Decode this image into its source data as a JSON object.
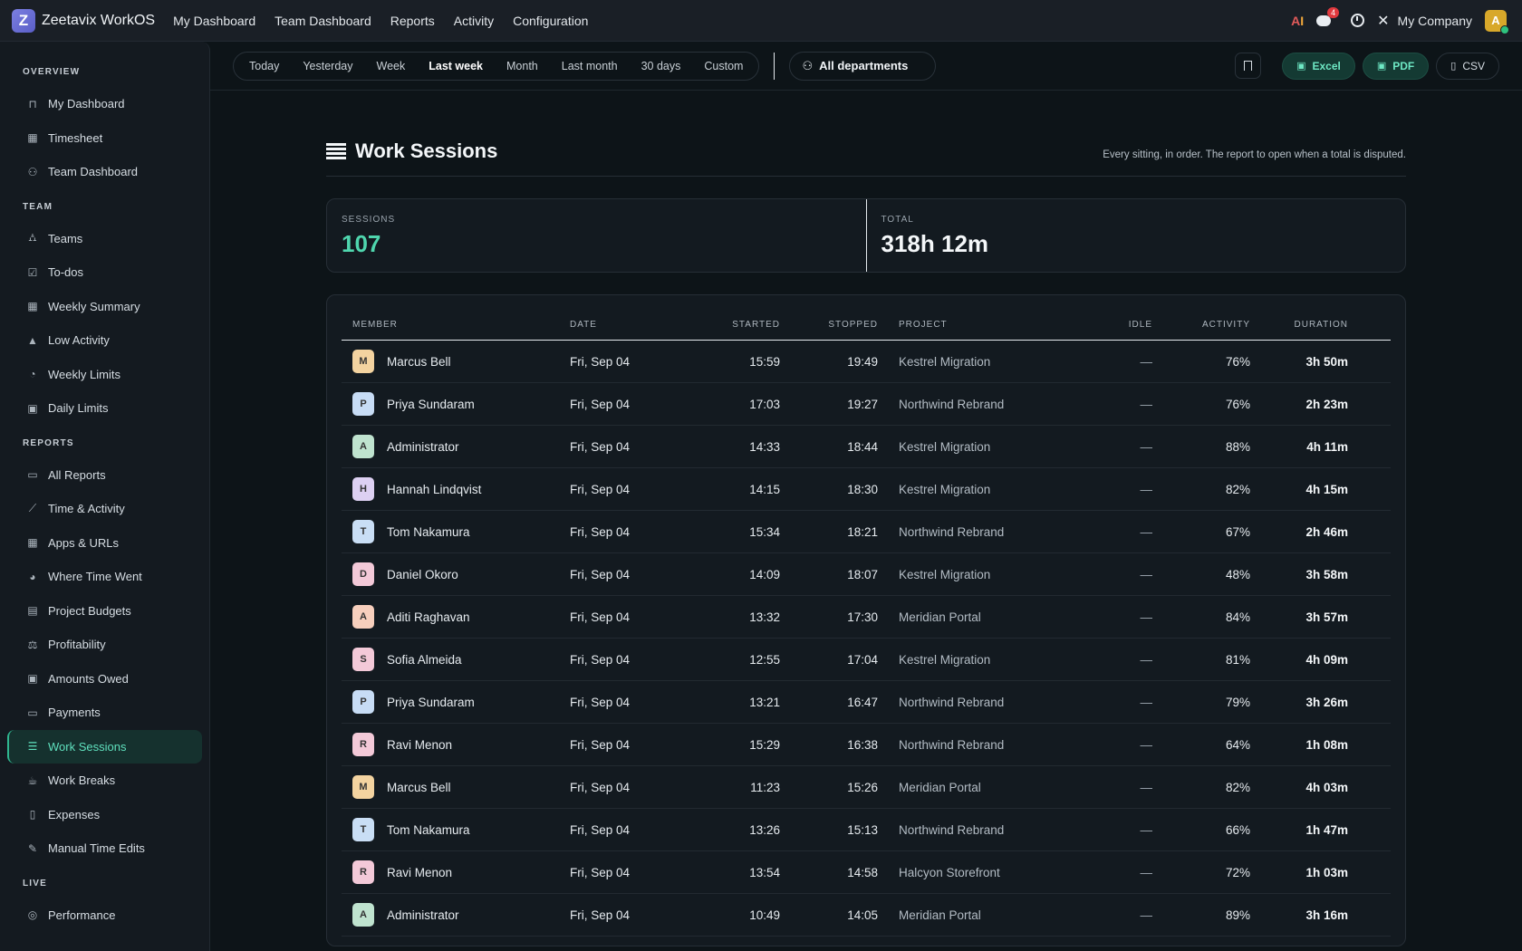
{
  "brand": {
    "logo_letter": "Z",
    "name": "Zeetavix WorkOS"
  },
  "topnav": [
    "My Dashboard",
    "Team Dashboard",
    "Reports",
    "Activity",
    "Configuration"
  ],
  "topright": {
    "ai_label_a": "A",
    "ai_label_i": "I",
    "chat_badge": "4",
    "company": "My Company",
    "avatar_letter": "A"
  },
  "sidebar": {
    "sections": [
      {
        "title": "OVERVIEW",
        "items": [
          {
            "label": "My Dashboard",
            "icon": "lock-icon",
            "glyph": "⊓"
          },
          {
            "label": "Timesheet",
            "icon": "calendar-icon",
            "glyph": "▦"
          },
          {
            "label": "Team Dashboard",
            "icon": "users-icon",
            "glyph": "⚇"
          }
        ]
      },
      {
        "title": "TEAM",
        "items": [
          {
            "label": "Teams",
            "icon": "sitemap-icon",
            "glyph": "⛼"
          },
          {
            "label": "To-dos",
            "icon": "checkbox-icon",
            "glyph": "☑"
          },
          {
            "label": "Weekly Summary",
            "icon": "grid-icon",
            "glyph": "▦"
          },
          {
            "label": "Low Activity",
            "icon": "warning-icon",
            "glyph": "▲"
          },
          {
            "label": "Weekly Limits",
            "icon": "gauge-icon",
            "glyph": "◔"
          },
          {
            "label": "Daily Limits",
            "icon": "calendar-check-icon",
            "glyph": "▣"
          }
        ]
      },
      {
        "title": "REPORTS",
        "items": [
          {
            "label": "All Reports",
            "icon": "folder-icon",
            "glyph": "▭"
          },
          {
            "label": "Time & Activity",
            "icon": "line-chart-icon",
            "glyph": "⟋"
          },
          {
            "label": "Apps & URLs",
            "icon": "apps-icon",
            "glyph": "▦"
          },
          {
            "label": "Where Time Went",
            "icon": "pie-chart-icon",
            "glyph": "◕"
          },
          {
            "label": "Project Budgets",
            "icon": "briefcase-icon",
            "glyph": "▤"
          },
          {
            "label": "Profitability",
            "icon": "scale-icon",
            "glyph": "⚖"
          },
          {
            "label": "Amounts Owed",
            "icon": "money-icon",
            "glyph": "▣"
          },
          {
            "label": "Payments",
            "icon": "credit-card-icon",
            "glyph": "▭"
          },
          {
            "label": "Work Sessions",
            "icon": "list-icon",
            "glyph": "☰",
            "active": true
          },
          {
            "label": "Work Breaks",
            "icon": "coffee-icon",
            "glyph": "☕"
          },
          {
            "label": "Expenses",
            "icon": "file-icon",
            "glyph": "▯"
          },
          {
            "label": "Manual Time Edits",
            "icon": "edit-icon",
            "glyph": "✎"
          }
        ]
      },
      {
        "title": "LIVE",
        "items": [
          {
            "label": "Performance",
            "icon": "target-icon",
            "glyph": "◎"
          }
        ]
      }
    ]
  },
  "toolbar": {
    "ranges": [
      "Today",
      "Yesterday",
      "Week",
      "Last week",
      "Month",
      "Last month",
      "30 days",
      "Custom"
    ],
    "active_range": "Last week",
    "department": "All departments",
    "exports": {
      "excel": "Excel",
      "pdf": "PDF",
      "csv": "CSV"
    }
  },
  "page": {
    "title": "Work Sessions",
    "subtitle": "Every sitting, in order. The report to open when a total is disputed."
  },
  "stats": {
    "sessions_label": "SESSIONS",
    "sessions_value": "107",
    "total_label": "TOTAL",
    "total_value": "318h 12m"
  },
  "table": {
    "headers": {
      "member": "MEMBER",
      "date": "DATE",
      "started": "STARTED",
      "stopped": "STOPPED",
      "project": "PROJECT",
      "idle": "IDLE",
      "activity": "ACTIVITY",
      "duration": "DURATION"
    },
    "rows": [
      {
        "initial": "M",
        "color": "#f3d3a0",
        "member": "Marcus Bell",
        "date": "Fri, Sep 04",
        "started": "15:59",
        "stopped": "19:49",
        "project": "Kestrel Migration",
        "idle": "—",
        "activity": "76%",
        "duration": "3h 50m"
      },
      {
        "initial": "P",
        "color": "#c7dcf5",
        "member": "Priya Sundaram",
        "date": "Fri, Sep 04",
        "started": "17:03",
        "stopped": "19:27",
        "project": "Northwind Rebrand",
        "idle": "—",
        "activity": "76%",
        "duration": "2h 23m"
      },
      {
        "initial": "A",
        "color": "#bfe3cf",
        "member": "Administrator",
        "date": "Fri, Sep 04",
        "started": "14:33",
        "stopped": "18:44",
        "project": "Kestrel Migration",
        "idle": "—",
        "activity": "88%",
        "duration": "4h 11m"
      },
      {
        "initial": "H",
        "color": "#ddd0f2",
        "member": "Hannah Lindqvist",
        "date": "Fri, Sep 04",
        "started": "14:15",
        "stopped": "18:30",
        "project": "Kestrel Migration",
        "idle": "—",
        "activity": "82%",
        "duration": "4h 15m"
      },
      {
        "initial": "T",
        "color": "#c9def5",
        "member": "Tom Nakamura",
        "date": "Fri, Sep 04",
        "started": "15:34",
        "stopped": "18:21",
        "project": "Northwind Rebrand",
        "idle": "—",
        "activity": "67%",
        "duration": "2h 46m"
      },
      {
        "initial": "D",
        "color": "#f3c9d8",
        "member": "Daniel Okoro",
        "date": "Fri, Sep 04",
        "started": "14:09",
        "stopped": "18:07",
        "project": "Kestrel Migration",
        "idle": "—",
        "activity": "48%",
        "duration": "3h 58m"
      },
      {
        "initial": "A",
        "color": "#f7cfbd",
        "member": "Aditi Raghavan",
        "date": "Fri, Sep 04",
        "started": "13:32",
        "stopped": "17:30",
        "project": "Meridian Portal",
        "idle": "—",
        "activity": "84%",
        "duration": "3h 57m"
      },
      {
        "initial": "S",
        "color": "#f3c9d8",
        "member": "Sofia Almeida",
        "date": "Fri, Sep 04",
        "started": "12:55",
        "stopped": "17:04",
        "project": "Kestrel Migration",
        "idle": "—",
        "activity": "81%",
        "duration": "4h 09m"
      },
      {
        "initial": "P",
        "color": "#c7dcf5",
        "member": "Priya Sundaram",
        "date": "Fri, Sep 04",
        "started": "13:21",
        "stopped": "16:47",
        "project": "Northwind Rebrand",
        "idle": "—",
        "activity": "79%",
        "duration": "3h 26m"
      },
      {
        "initial": "R",
        "color": "#f3c9d8",
        "member": "Ravi Menon",
        "date": "Fri, Sep 04",
        "started": "15:29",
        "stopped": "16:38",
        "project": "Northwind Rebrand",
        "idle": "—",
        "activity": "64%",
        "duration": "1h 08m"
      },
      {
        "initial": "M",
        "color": "#f3d3a0",
        "member": "Marcus Bell",
        "date": "Fri, Sep 04",
        "started": "11:23",
        "stopped": "15:26",
        "project": "Meridian Portal",
        "idle": "—",
        "activity": "82%",
        "duration": "4h 03m"
      },
      {
        "initial": "T",
        "color": "#c9def5",
        "member": "Tom Nakamura",
        "date": "Fri, Sep 04",
        "started": "13:26",
        "stopped": "15:13",
        "project": "Northwind Rebrand",
        "idle": "—",
        "activity": "66%",
        "duration": "1h 47m"
      },
      {
        "initial": "R",
        "color": "#f3c9d8",
        "member": "Ravi Menon",
        "date": "Fri, Sep 04",
        "started": "13:54",
        "stopped": "14:58",
        "project": "Halcyon Storefront",
        "idle": "—",
        "activity": "72%",
        "duration": "1h 03m"
      },
      {
        "initial": "A",
        "color": "#bfe3cf",
        "member": "Administrator",
        "date": "Fri, Sep 04",
        "started": "10:49",
        "stopped": "14:05",
        "project": "Meridian Portal",
        "idle": "—",
        "activity": "89%",
        "duration": "3h 16m"
      }
    ]
  }
}
